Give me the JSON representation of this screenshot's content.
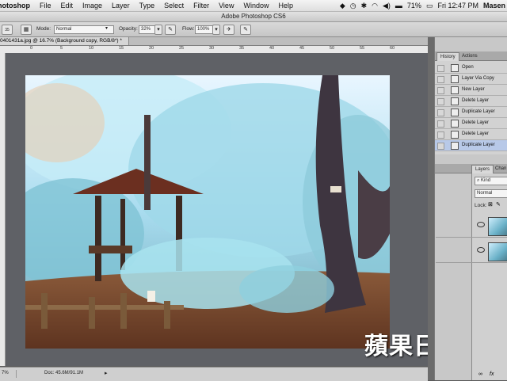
{
  "menubar": {
    "app_name": "hotoshop",
    "items": [
      "File",
      "Edit",
      "Image",
      "Layer",
      "Type",
      "Select",
      "Filter",
      "View",
      "Window",
      "Help"
    ],
    "battery": "71%",
    "datetime": "Fri 12:47 PM",
    "user": "Masen"
  },
  "window": {
    "title": "Adobe Photoshop CS6"
  },
  "options": {
    "mode_label": "Mode:",
    "mode_value": "Normal",
    "opacity_label": "Opacity:",
    "opacity_value": "32%",
    "flow_label": "Flow:",
    "flow_value": "100%",
    "brush_size": "35"
  },
  "document": {
    "tab_title": "0401431a.jpg @ 16.7% (Background copy, RGB/8*) *",
    "status_zoom": "7%",
    "status_doc": "Doc: 45.6M/91.1M"
  },
  "ruler": {
    "marks": [
      "0",
      "5",
      "10",
      "15",
      "20",
      "25",
      "30",
      "35",
      "40",
      "45",
      "50",
      "55",
      "60"
    ]
  },
  "history_panel": {
    "tabs": [
      "History",
      "Actions"
    ],
    "items": [
      {
        "label": "Open"
      },
      {
        "label": "Layer Via Copy"
      },
      {
        "label": "New Layer"
      },
      {
        "label": "Delete Layer"
      },
      {
        "label": "Duplicate Layer"
      },
      {
        "label": "Delete Layer"
      },
      {
        "label": "Delete Layer"
      },
      {
        "label": "Duplicate Layer"
      }
    ]
  },
  "layers_panel": {
    "tabs": [
      "Layers",
      "Chan"
    ],
    "filter_label": "Kind",
    "blend_mode": "Normal",
    "lock_label": "Lock:"
  },
  "watermark": "蘋果日報",
  "colors": {
    "accent_selection": "#b8c9e8",
    "canvas_bg": "#5f6166"
  }
}
